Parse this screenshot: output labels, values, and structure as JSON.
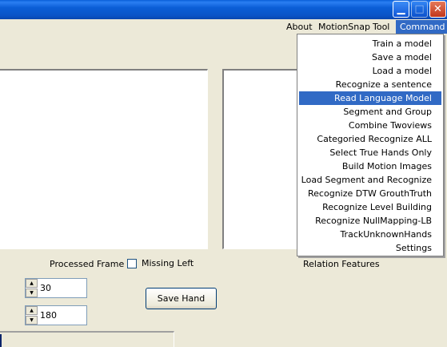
{
  "window": {
    "controls": [
      {
        "name": "minimize",
        "glyph": "▁"
      },
      {
        "name": "maximize",
        "glyph": "□"
      },
      {
        "name": "close",
        "glyph": "✕"
      }
    ]
  },
  "menubar": {
    "items": [
      "About",
      "MotionSnap",
      "Tool",
      "Command"
    ],
    "active": "Command"
  },
  "command_menu": {
    "items": [
      "Train a model",
      "Save a model",
      "Load a model",
      "Recognize a sentence",
      "Read Language Model",
      "Segment and Group",
      "Combine Twoviews",
      "Categoried Recognize ALL",
      "Select True Hands Only",
      "Build Motion Images",
      "Load Segment and Recognize",
      "Recognize DTW GrouthTruth",
      "Recognize Level Building",
      "Recognize NullMapping-LB",
      "TrackUnknownHands",
      "Settings"
    ],
    "highlighted": "Read Language Model"
  },
  "labels": {
    "processed_frame": "Processed Frame",
    "missing_left": "Missing Left",
    "relation_features": "Relation Features"
  },
  "spinners": {
    "first_value": "30",
    "second_value": "180"
  },
  "buttons": {
    "save_hand": "Save Hand"
  },
  "colors": {
    "menu_highlight": "#316ac5",
    "titlebar": "#0a54c8",
    "background": "#ece9d8"
  }
}
